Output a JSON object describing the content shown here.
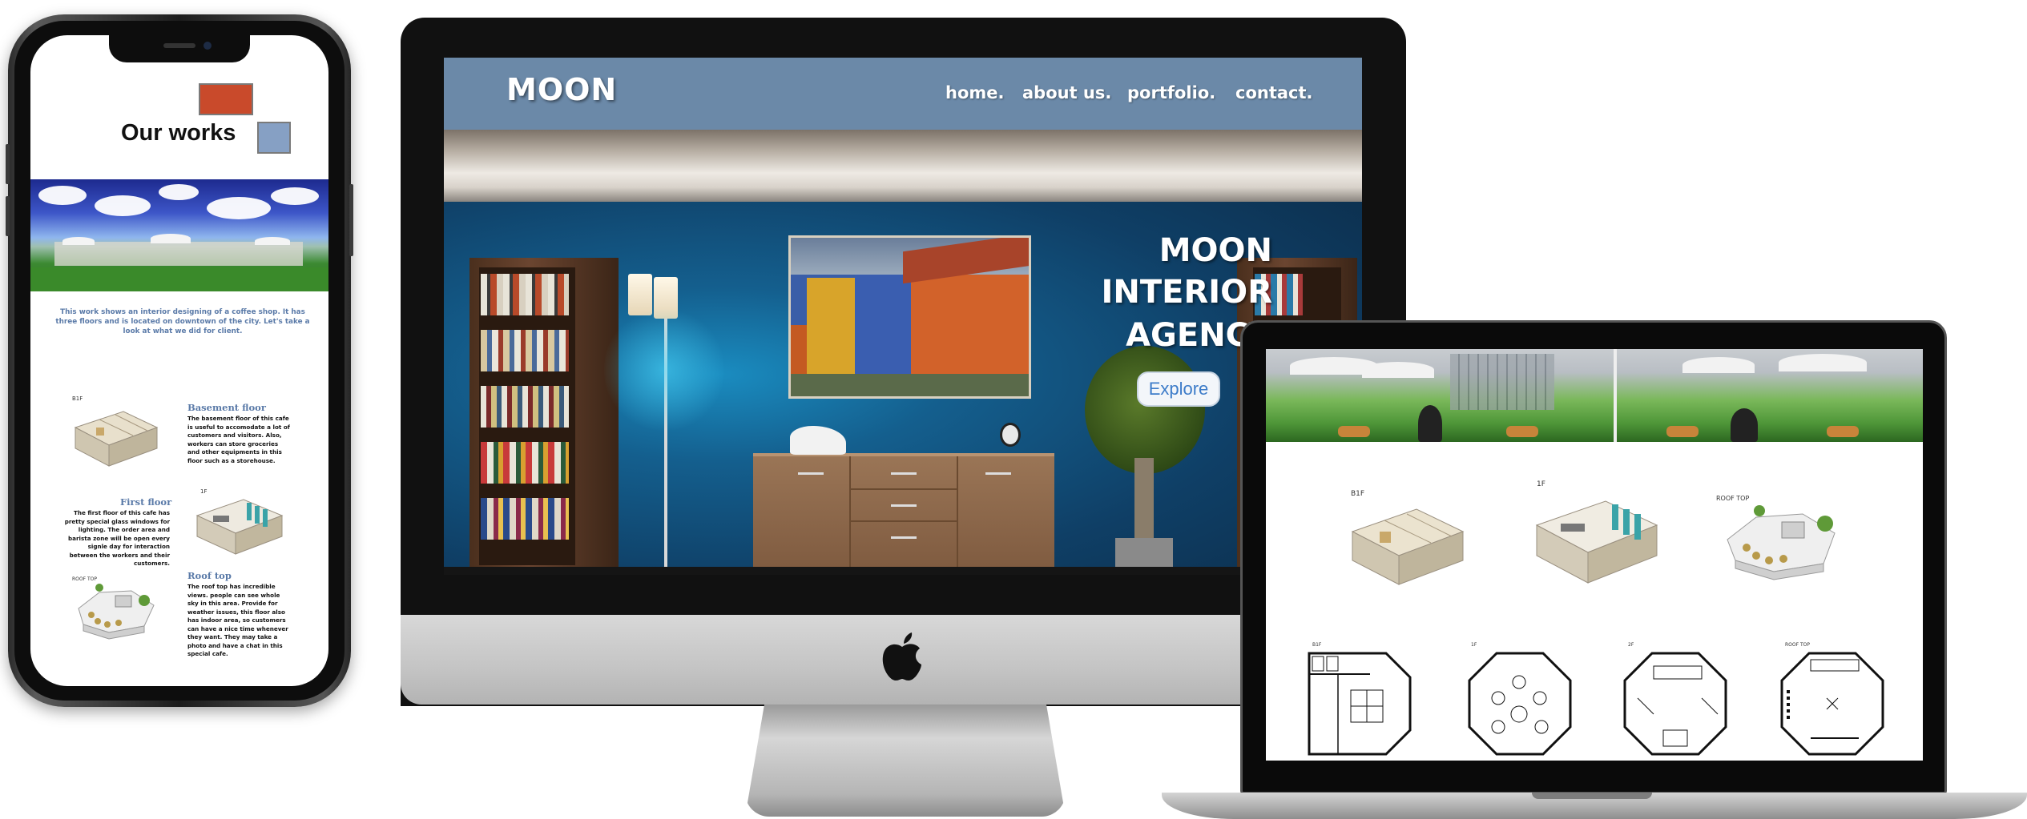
{
  "mobile": {
    "title": "Our works",
    "intro": "This work shows an interior designing of a coffee shop. It has three floors and is located on downtown of the city. Let's take a look at what we did for client.",
    "sections": [
      {
        "floor_label": "B1F",
        "heading": "Basement floor",
        "text": "The basement floor of this cafe is useful to accomodate a lot of customers and visitors. Also, workers can store groceries and other equipments in this floor such as a storehouse."
      },
      {
        "floor_label": "1F",
        "heading": "First floor",
        "text": "The first floor of this cafe has pretty special glass windows for lighting. The order area and barista zone will be open every signle day for interaction between the workers and their customers."
      },
      {
        "floor_label": "ROOF TOP",
        "heading": "Roof top",
        "text": "The roof top has incredible views. people can see whole sky in this area. Provide for weather issues, this floor also has indoor area, so customers can have a nice time whenever they want. They may take a photo and have a chat in this special cafe."
      }
    ]
  },
  "desktop": {
    "logo": "MOON",
    "nav": [
      "home.",
      "about us.",
      "portfolio.",
      "contact."
    ],
    "hero_lines": [
      "MOON",
      "INTERIOR",
      "AGENCY"
    ],
    "cta": "Explore"
  },
  "laptop": {
    "render_labels": [
      "B1F",
      "1F",
      "ROOF TOP"
    ],
    "plan_labels": [
      "B1F",
      "1F",
      "2F",
      "ROOF TOP"
    ]
  },
  "colors": {
    "header_blue": "#6b89a8",
    "accent_red": "#c94a2b",
    "accent_blue": "#86a0c4",
    "heading_blue": "#5a7aa8",
    "cta_text": "#3d7cc9"
  }
}
